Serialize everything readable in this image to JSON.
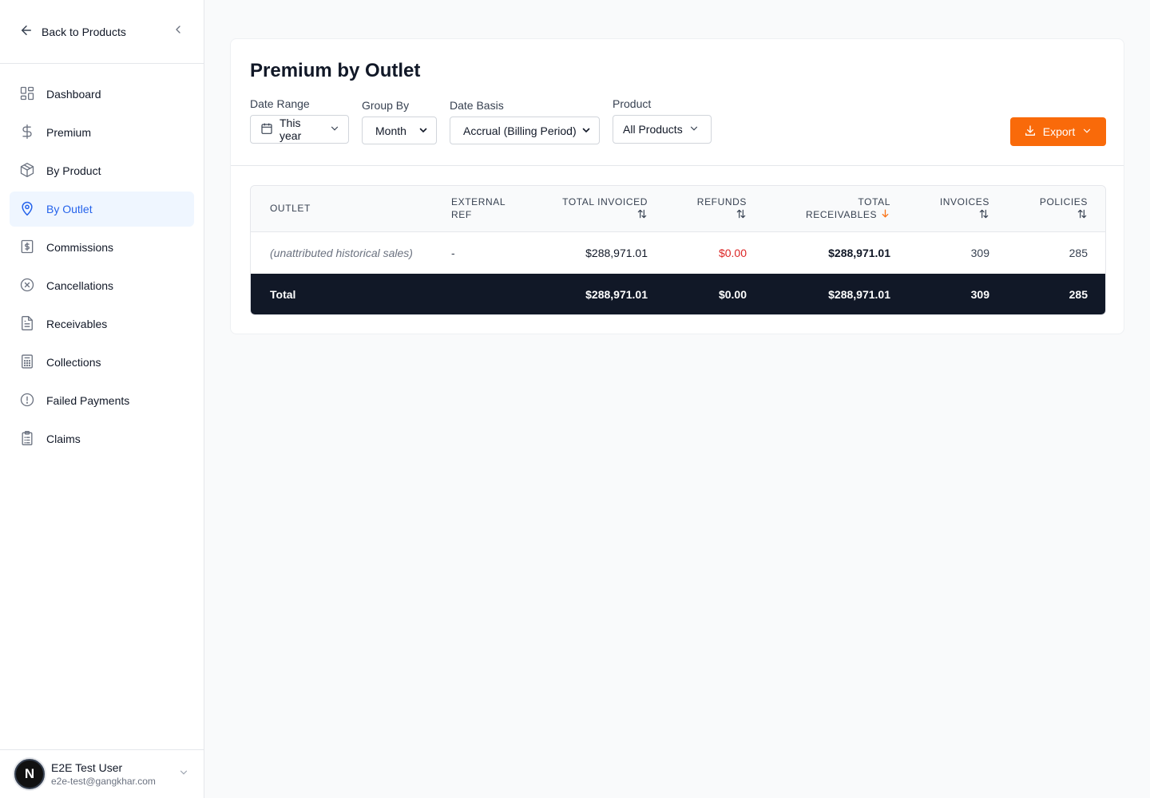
{
  "sidebar": {
    "back_label": "Back to Products",
    "items": [
      {
        "label": "Dashboard",
        "icon": "dashboard-icon",
        "active": false
      },
      {
        "label": "Premium",
        "icon": "dollar-icon",
        "active": false
      },
      {
        "label": "By Product",
        "icon": "package-icon",
        "active": false
      },
      {
        "label": "By Outlet",
        "icon": "location-pin-icon",
        "active": true
      },
      {
        "label": "Commissions",
        "icon": "receipt-dollar-icon",
        "active": false
      },
      {
        "label": "Cancellations",
        "icon": "x-circle-icon",
        "active": false
      },
      {
        "label": "Receivables",
        "icon": "document-icon",
        "active": false
      },
      {
        "label": "Collections",
        "icon": "calculator-icon",
        "active": false
      },
      {
        "label": "Failed Payments",
        "icon": "alert-circle-icon",
        "active": false
      },
      {
        "label": "Claims",
        "icon": "clipboard-icon",
        "active": false
      }
    ],
    "user": {
      "initial": "N",
      "name": "E2E Test User",
      "email": "e2e-test@gangkhar.com"
    }
  },
  "page": {
    "title": "Premium by Outlet",
    "filters": {
      "date_range": {
        "label": "Date Range",
        "value": "This year"
      },
      "group_by": {
        "label": "Group By",
        "value": "Month"
      },
      "date_basis": {
        "label": "Date Basis",
        "value": "Accrual (Billing Period)"
      },
      "product": {
        "label": "Product",
        "value": "All Products"
      }
    },
    "export_label": "Export"
  },
  "table": {
    "columns": [
      {
        "line1": "OUTLET",
        "line2": ""
      },
      {
        "line1": "EXTERNAL",
        "line2": "REF"
      },
      {
        "line1": "TOTAL INVOICED",
        "line2": ""
      },
      {
        "line1": "REFUNDS",
        "line2": ""
      },
      {
        "line1": "TOTAL",
        "line2": "RECEIVABLES"
      },
      {
        "line1": "INVOICES",
        "line2": ""
      },
      {
        "line1": "POLICIES",
        "line2": ""
      }
    ],
    "rows": [
      {
        "outlet": "(unattributed historical sales)",
        "external_ref": "-",
        "total_invoiced": "$288,971.01",
        "refunds": "$0.00",
        "total_receivables": "$288,971.01",
        "invoices": "309",
        "policies": "285"
      }
    ],
    "total": {
      "label": "Total",
      "total_invoiced": "$288,971.01",
      "refunds": "$0.00",
      "total_receivables": "$288,971.01",
      "invoices": "309",
      "policies": "285"
    },
    "sorted_column_color": "#f97316"
  },
  "colors": {
    "accent": "#2563eb",
    "export": "#f96a0a",
    "refund_red": "#dc2626",
    "total_row": "#111827"
  }
}
